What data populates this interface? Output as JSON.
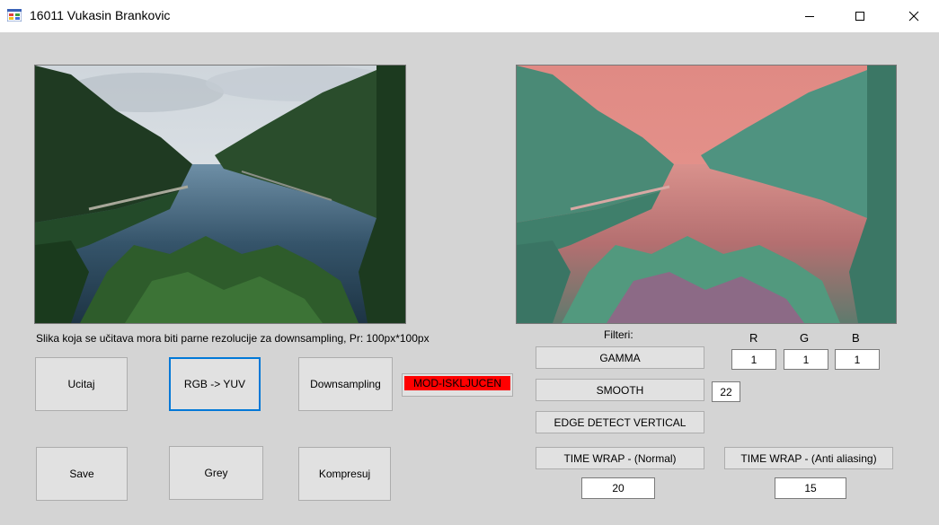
{
  "window": {
    "title": "16011 Vukasin Brankovic",
    "app_icon": "winforms-app-icon",
    "controls": [
      "minimize-icon",
      "maximize-icon",
      "close-icon"
    ]
  },
  "images": {
    "left": "original-landscape-lake-forest",
    "right": "yuv-converted-landscape-lake-forest"
  },
  "info_text": "Slika koja se učitava mora biti parne rezolucije za downsampling, Pr: 100px*100px",
  "buttons": {
    "ucitaj": "Ucitaj",
    "rgb_yuv": "RGB -> YUV",
    "downsampling": "Downsampling",
    "save": "Save",
    "grey": "Grey",
    "kompresuj": "Kompresuj"
  },
  "mode_label": "MOD-ISKLJUCEN",
  "filters": {
    "title": "Filteri:",
    "gamma": "GAMMA",
    "smooth": "SMOOTH",
    "edge": "EDGE DETECT VERTICAL",
    "tw_normal": "TIME WRAP - (Normal)",
    "tw_anti": "TIME WRAP - (Anti aliasing)"
  },
  "rgb": {
    "r_label": "R",
    "g_label": "G",
    "b_label": "B",
    "r": "1",
    "g": "1",
    "b": "1"
  },
  "smooth_value": "22",
  "tw_normal_value": "20",
  "tw_anti_value": "15",
  "colors": {
    "focus_border": "#0078d7",
    "mode_bg": "#ff0000",
    "form_bg": "#d4d4d4"
  }
}
